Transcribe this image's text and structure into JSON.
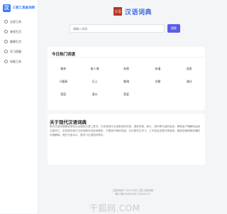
{
  "brand": {
    "logo_char": "汉",
    "name": "三君工具查询网"
  },
  "sidebar": {
    "items": [
      {
        "label": "全部工具"
      },
      {
        "label": "查找生活"
      },
      {
        "label": "健康生活"
      },
      {
        "label": "学习提醒"
      },
      {
        "label": "电脑工具"
      }
    ]
  },
  "header": {
    "logo_char": "汉语",
    "title": "汉语词典"
  },
  "search": {
    "placeholder": "请输入词语",
    "button_label": "搜索"
  },
  "hot_words": {
    "title": "今日热门词语",
    "items": [
      "尊贵",
      "故人情",
      "有害",
      "恭谨",
      "成家",
      "小暖春",
      "日土",
      "鲁瑰",
      "辛酸",
      "渊谷",
      "宽容",
      "清水",
      "宽爱"
    ]
  },
  "about": {
    "title": "关于现代汉语词典",
    "text": "现代汉语词典是收录较为全面的汉语工具书，它收录现代汉语常用的词语，提供拼音、释义、例句等丰富的信息，帮助用户理解和运用汉语词汇。本站提供现代汉语词典在线查询服务，方便用户随时查阅。无论是学生学习、工作查证还是日常使用，都能快速获取准确的词语解释，提升汉语水平，是学习汉语的好帮手。"
  },
  "footer": {
    "line1": "三君查询网 © 2019-2025 三君工具查询网",
    "line2": "湘ICP备12345678号-2  2025-05-21"
  },
  "watermark": "千狐网.COM"
}
